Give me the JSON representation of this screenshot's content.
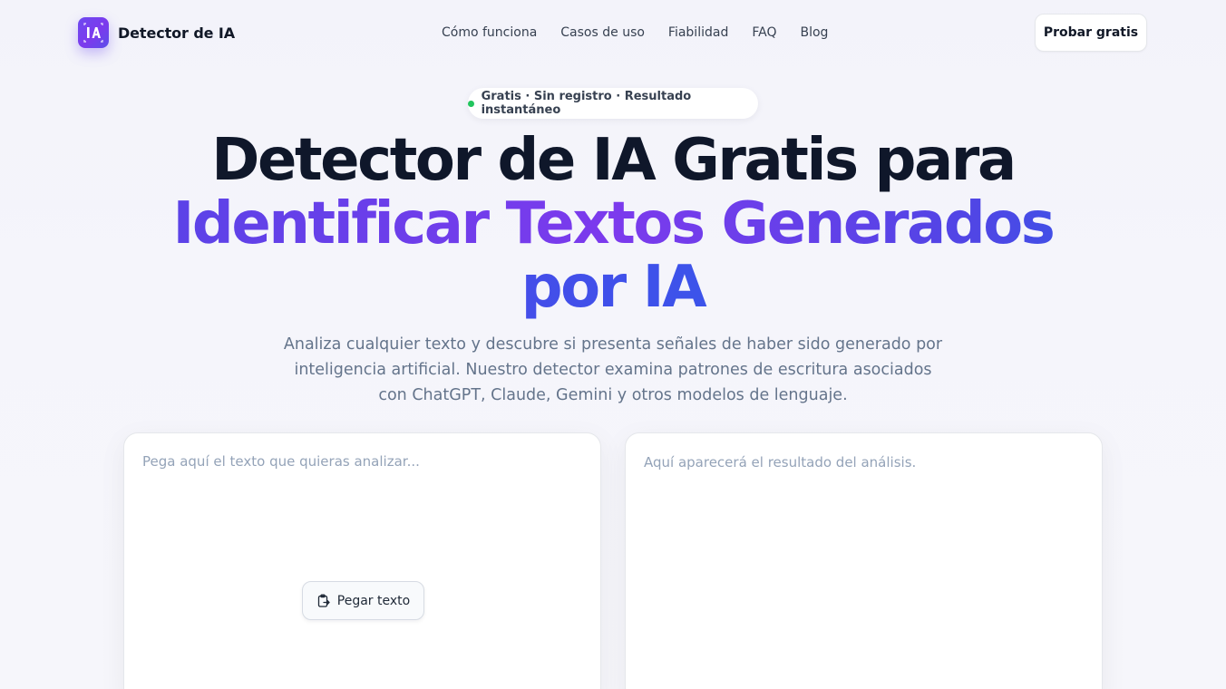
{
  "brand": {
    "logo_icon": "ia-logo-icon",
    "name": "Detector de IA",
    "accent": "#6d4af0"
  },
  "nav": {
    "items": [
      {
        "label": "Cómo funciona"
      },
      {
        "label": "Casos de uso"
      },
      {
        "label": "Fiabilidad"
      },
      {
        "label": "FAQ"
      },
      {
        "label": "Blog"
      }
    ],
    "cta_label": "Probar gratis"
  },
  "badge": {
    "text": "Gratis · Sin registro · Resultado instantáneo",
    "dot_color": "#22c55e"
  },
  "hero": {
    "title_line1": "Detector de IA Gratis para",
    "title_line2": "Identificar Textos Generados",
    "title_line3": "por IA",
    "subtitle": "Analiza cualquier texto y descubre si presenta señales de haber sido generado por inteligencia artificial. Nuestro detector examina patrones de escritura asociados con ChatGPT, Claude, Gemini y otros modelos de lenguaje."
  },
  "input_panel": {
    "placeholder": "Pega aquí el texto que quieras analizar...",
    "value": "",
    "paste_label": "Pegar texto",
    "paste_icon": "clipboard-paste-icon"
  },
  "result_panel": {
    "placeholder": "Aquí aparecerá el resultado del análisis."
  }
}
